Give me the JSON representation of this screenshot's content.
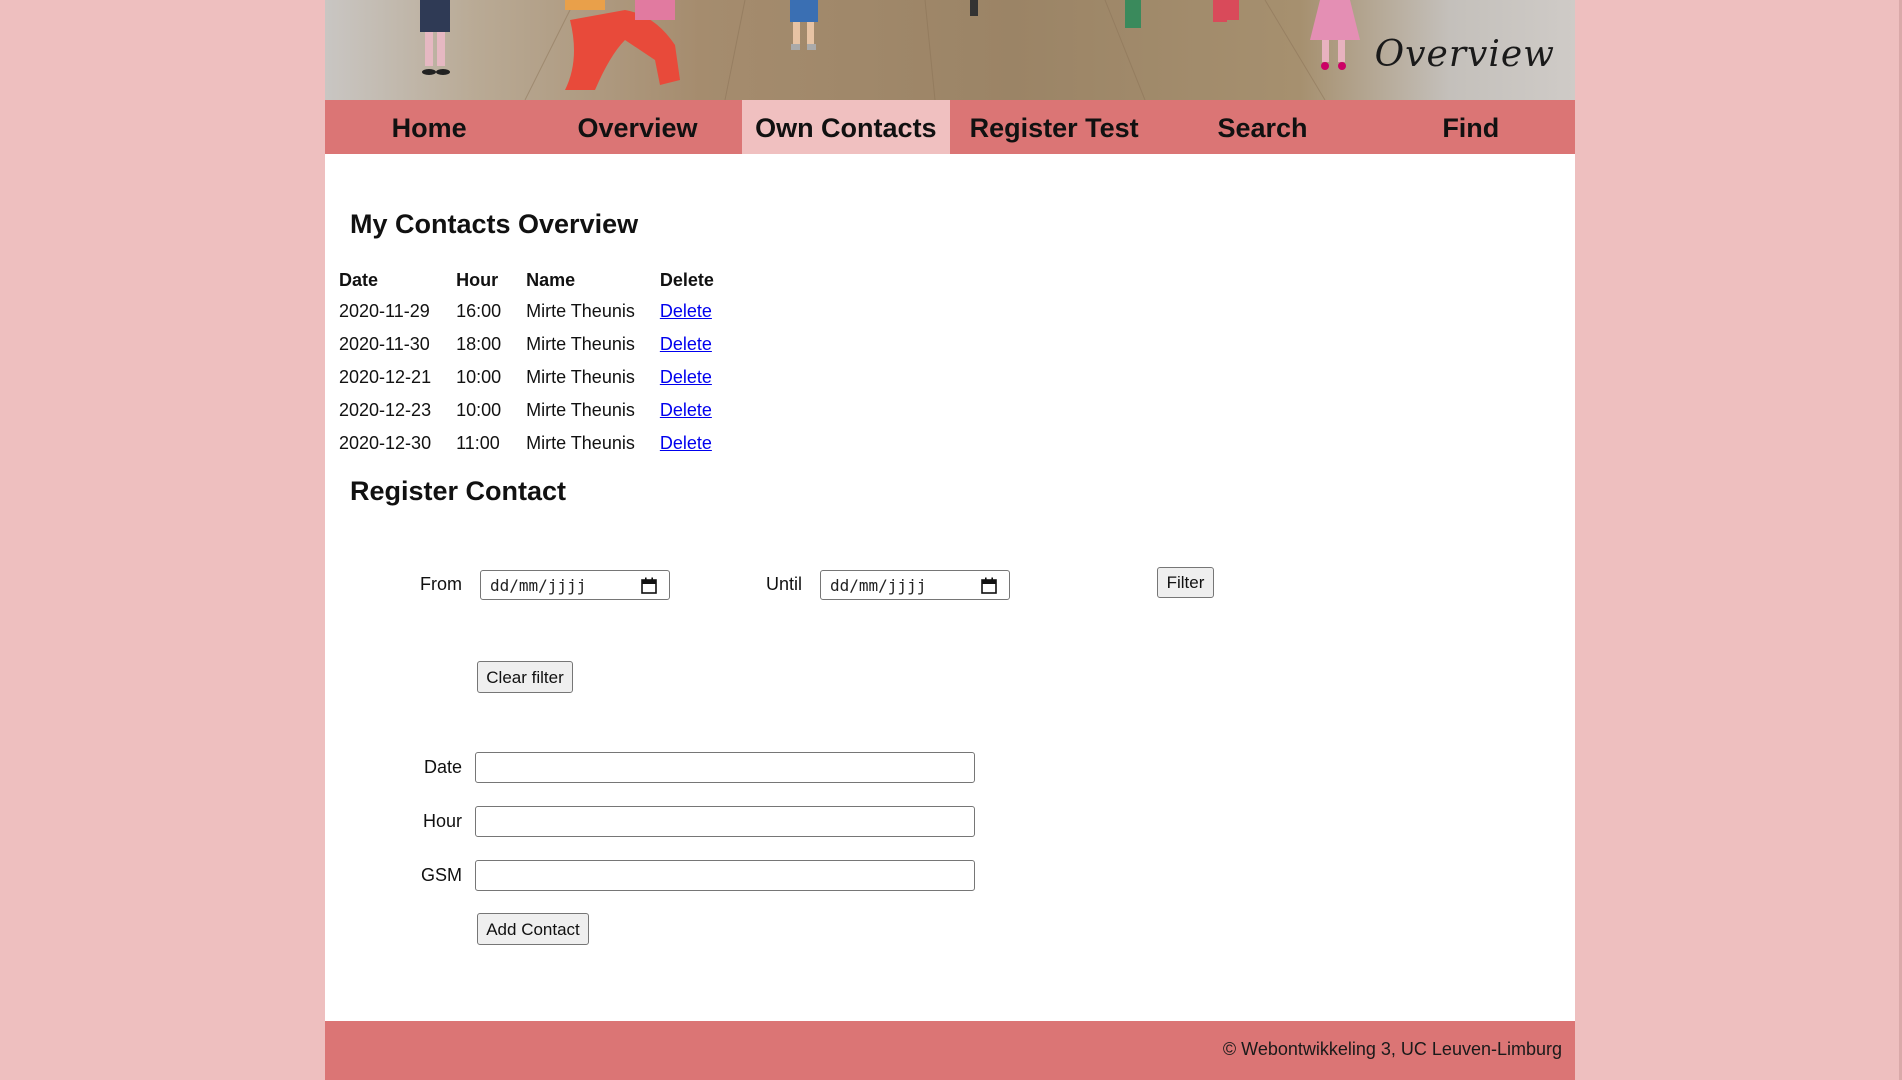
{
  "banner": {
    "title": "Overview"
  },
  "nav": {
    "items": [
      {
        "label": "Home"
      },
      {
        "label": "Overview"
      },
      {
        "label": "Own Contacts"
      },
      {
        "label": "Register Test"
      },
      {
        "label": "Search"
      },
      {
        "label": "Find"
      }
    ],
    "active": "Own Contacts"
  },
  "contacts": {
    "heading": "My Contacts Overview",
    "columns": [
      "Date",
      "Hour",
      "Name",
      "Delete"
    ],
    "rows": [
      {
        "date": "2020-11-29",
        "hour": "16:00",
        "name": "Mirte Theunis",
        "action": "Delete"
      },
      {
        "date": "2020-11-30",
        "hour": "18:00",
        "name": "Mirte Theunis",
        "action": "Delete"
      },
      {
        "date": "2020-12-21",
        "hour": "10:00",
        "name": "Mirte Theunis",
        "action": "Delete"
      },
      {
        "date": "2020-12-23",
        "hour": "10:00",
        "name": "Mirte Theunis",
        "action": "Delete"
      },
      {
        "date": "2020-12-30",
        "hour": "11:00",
        "name": "Mirte Theunis",
        "action": "Delete"
      }
    ]
  },
  "register": {
    "heading": "Register Contact",
    "filter": {
      "from_label": "From",
      "from_placeholder": "dd/mm/jjjj",
      "until_label": "Until",
      "until_placeholder": "dd/mm/jjjj",
      "filter_button": "Filter",
      "clear_button": "Clear filter"
    },
    "form": {
      "date_label": "Date",
      "date_value": "",
      "hour_label": "Hour",
      "hour_value": "",
      "gsm_label": "GSM",
      "gsm_value": "",
      "submit_button": "Add Contact"
    }
  },
  "footer": {
    "text": "© Webontwikkeling 3, UC Leuven-Limburg"
  },
  "colors": {
    "page_background": "#eebfbf",
    "nav_background": "#db7575",
    "nav_active": "#f0c0c0",
    "link": "#0000ee"
  }
}
